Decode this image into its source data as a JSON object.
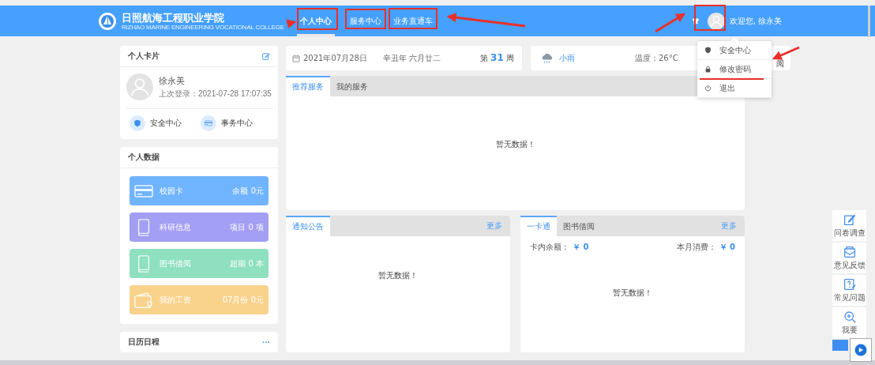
{
  "header": {
    "school_name": "日照航海工程职业学院",
    "school_subtitle": "RIZHAO MARINE ENGINEERING VOCATIONAL COLLEGE",
    "nav": [
      {
        "label": "个人中心",
        "selected": true
      },
      {
        "label": "服务中心",
        "selected": false
      },
      {
        "label": "业务直通车",
        "selected": false
      }
    ],
    "welcome": "欢迎您, 徐永美"
  },
  "user_menu": [
    {
      "kind": "shield",
      "label": "安全中心"
    },
    {
      "kind": "lock",
      "label": "修改密码"
    },
    {
      "kind": "power",
      "label": "退出"
    }
  ],
  "profile_card": {
    "title": "个人卡片",
    "name": "徐永美",
    "last_login": "上次登录：2021-07-28 17:07:35",
    "links": [
      {
        "kind": "shield",
        "label": "安全中心"
      },
      {
        "kind": "card",
        "label": "事务中心"
      }
    ]
  },
  "personal_data": {
    "title": "个人数据",
    "items": [
      {
        "kind": "card",
        "label": "校园卡",
        "value": "余额 0元",
        "color": "#70b4ff"
      },
      {
        "kind": "book",
        "label": "科研信息",
        "value": "项目 0 项",
        "color": "#a29ff4"
      },
      {
        "kind": "book",
        "label": "图书借阅",
        "value": "超期 0 本",
        "color": "#8ee0bf"
      },
      {
        "kind": "wallet",
        "label": "我的工资",
        "value": "07月份 0元",
        "color": "#f9d28c"
      }
    ]
  },
  "calendar": {
    "title": "日历日程",
    "more": "···"
  },
  "date_bar": {
    "date": "2021年07月28日",
    "lunar": "辛丑年 六月廿二",
    "week_prefix": "第",
    "week_number": "31",
    "week_suffix": "周"
  },
  "weather": {
    "condition": "小雨",
    "temperature": "温度：26°C",
    "partial_label": "阅"
  },
  "services": {
    "tabs": [
      {
        "label": "推荐服务",
        "selected": true
      },
      {
        "label": "我的服务",
        "selected": false
      }
    ],
    "empty": "暂无数据！"
  },
  "notices": {
    "tabs": [
      {
        "label": "通知公告",
        "selected": true
      }
    ],
    "more": "更多",
    "empty": "暂无数据！"
  },
  "card_panel": {
    "tabs": [
      {
        "label": "一卡通",
        "selected": true
      },
      {
        "label": "图书借阅",
        "selected": false
      }
    ],
    "more": "更多",
    "balance_label": "卡内余额：",
    "balance": "￥ 0",
    "spend_label": "本月消费：",
    "spend": "￥ 0",
    "empty": "暂无数据！"
  },
  "side_tools": [
    {
      "kind": "edit",
      "label": "问卷调查"
    },
    {
      "kind": "mail",
      "label": "意见反馈"
    },
    {
      "kind": "question",
      "label": "常见问题"
    },
    {
      "kind": "zoom",
      "label": "我要"
    }
  ]
}
